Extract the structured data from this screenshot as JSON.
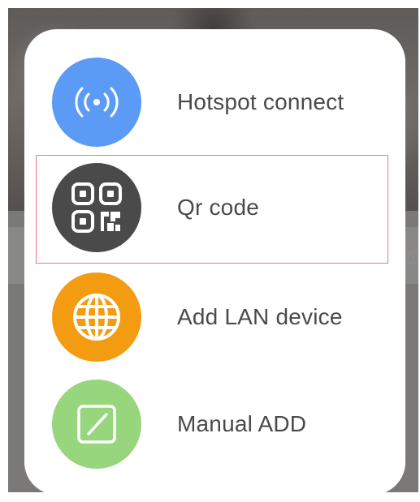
{
  "dialog": {
    "items": [
      {
        "label": "Hotspot connect",
        "icon": "wifi-hotspot-icon",
        "color": "#5b9af5",
        "selected": false
      },
      {
        "label": "Qr code",
        "icon": "qr-code-icon",
        "color": "#4a4a4a",
        "selected": true
      },
      {
        "label": "Add LAN device",
        "icon": "globe-icon",
        "color": "#f39c12",
        "selected": false
      },
      {
        "label": "Manual ADD",
        "icon": "edit-icon",
        "color": "#97d67c",
        "selected": false
      }
    ],
    "selection_outline_color": "#e47c80"
  }
}
